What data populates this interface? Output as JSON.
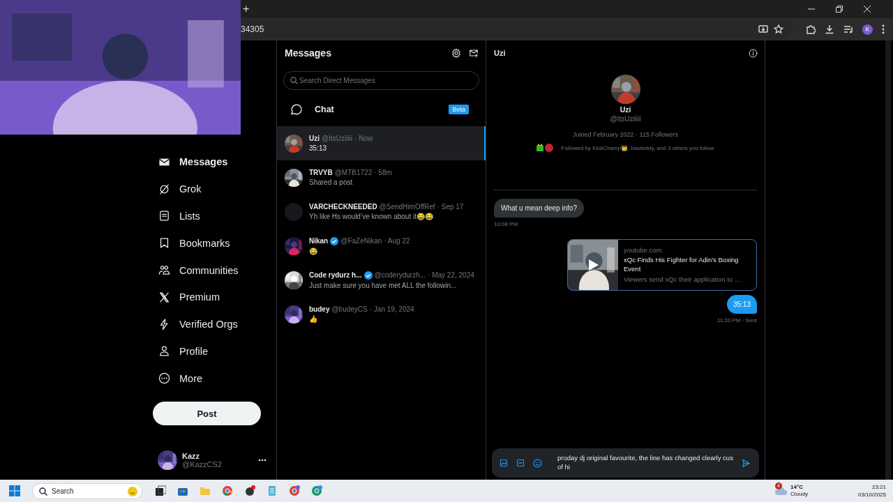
{
  "browser": {
    "new_tab": "+",
    "url": "34305",
    "profile_initial": "K"
  },
  "nav": {
    "items": [
      {
        "label": "Messages",
        "kind": "mail",
        "selected": true
      },
      {
        "label": "Grok",
        "kind": "grok",
        "selected": false
      },
      {
        "label": "Lists",
        "kind": "list",
        "selected": false
      },
      {
        "label": "Bookmarks",
        "kind": "bookmark",
        "selected": false
      },
      {
        "label": "Communities",
        "kind": "people",
        "selected": false
      },
      {
        "label": "Premium",
        "kind": "x",
        "selected": false
      },
      {
        "label": "Verified Orgs",
        "kind": "bolt",
        "selected": false
      },
      {
        "label": "Profile",
        "kind": "person",
        "selected": false
      },
      {
        "label": "More",
        "kind": "more",
        "selected": false
      }
    ],
    "post_button": "Post",
    "account": {
      "name": "Kazz",
      "handle": "@KazzCS2"
    }
  },
  "messages": {
    "title": "Messages",
    "search": {
      "placeholder": "Search Direct Messages"
    },
    "chat": {
      "label": "Chat",
      "badge": "Beta"
    },
    "conversations": [
      {
        "name": "Uzi",
        "verified": false,
        "handle": "@ItsUziiiii",
        "time": "· Now",
        "preview": "35:13",
        "kind": "picture",
        "selected": true
      },
      {
        "name": "TRVYB",
        "verified": false,
        "handle": "@MTB1722",
        "time": "· 58m",
        "preview": "Shared a post",
        "kind": "picture",
        "selected": false
      },
      {
        "name": "VARCHECKNEEDED",
        "verified": false,
        "handle": "@SendHimOffRef",
        "time": "· Sep 17",
        "preview": "Yh like Hs would’ve known about it😂😂",
        "kind": "blank",
        "selected": false
      },
      {
        "name": "Nikan",
        "verified": true,
        "handle": "@FaZeNikan",
        "time": "· Aug 22",
        "preview": "😂",
        "kind": "picture",
        "selected": false
      },
      {
        "name": "Code rydurz h...",
        "verified": true,
        "handle": "@coderydurzh...",
        "time": "· May 22, 2024",
        "preview": "Just make sure you have met ALL the followin...",
        "kind": "picture",
        "selected": false
      },
      {
        "name": "budey",
        "verified": false,
        "handle": "@budeyCS",
        "time": "· Jan 19, 2024",
        "preview": "👍",
        "kind": "picture",
        "selected": false
      }
    ]
  },
  "conversation": {
    "title": "Uzi",
    "profile": {
      "name": "Uzi",
      "handle": "@ItsUziiiii",
      "joined": "Joined February 2022 · 115 Followers",
      "followed_by": "Followed by KickChamp👑, bauteddy, and 3 others you follow"
    },
    "items": [
      {
        "kind": "received",
        "text": "What u mean deep info?",
        "time": "10:08 PM"
      },
      {
        "kind": "link_card",
        "domain": "youtube.com",
        "title": "xQc Finds His Fighter for Adin’s Boxing Event",
        "description": "Viewers send xQc their application to ..."
      },
      {
        "kind": "sent",
        "text": "35:13",
        "time": "11:20 PM · Sent"
      }
    ],
    "composer": {
      "value": "proday dj original favourite, the line has changed clearly cus of hi"
    }
  },
  "taskbar": {
    "search": {
      "placeholder": "Search"
    },
    "weather": {
      "badge": "4",
      "temperature": "14°C",
      "condition": "Cloudy"
    },
    "clock": {
      "time": "23:21",
      "date": "03/10/2025"
    }
  }
}
